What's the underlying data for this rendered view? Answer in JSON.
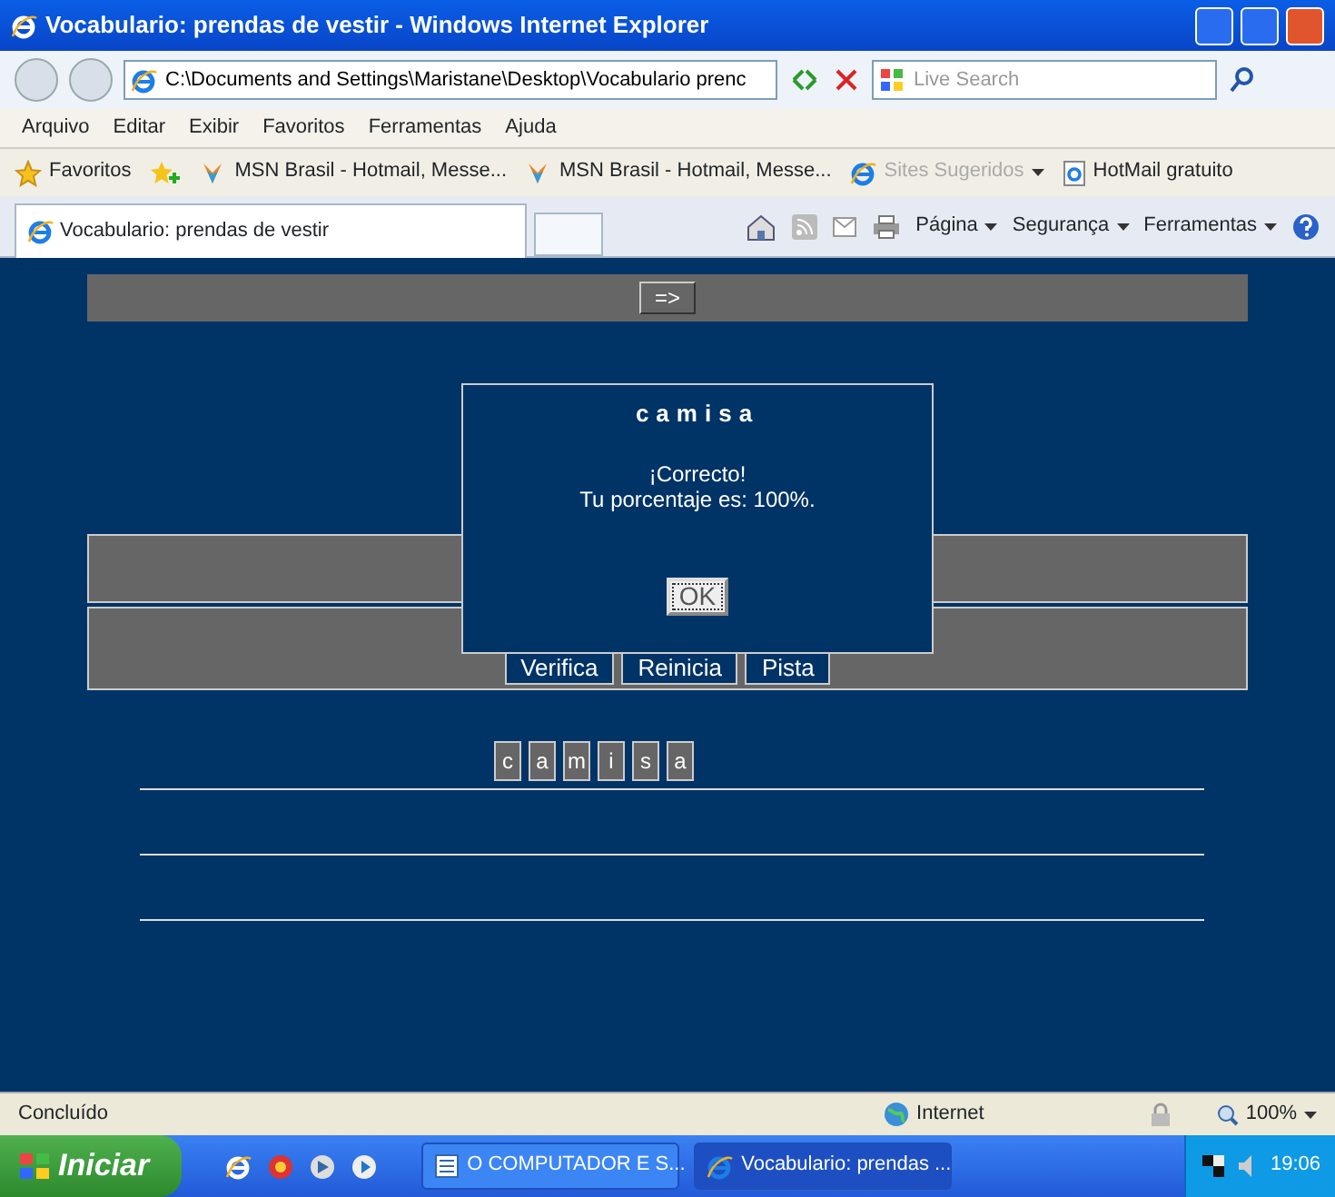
{
  "window": {
    "title": "Vocabulario: prendas de vestir - Windows Internet Explorer"
  },
  "address_bar": {
    "value": "C:\\Documents and Settings\\Maristane\\Desktop\\Vocabulario prenc"
  },
  "search": {
    "placeholder": "Live Search"
  },
  "menu": [
    "Arquivo",
    "Editar",
    "Exibir",
    "Favoritos",
    "Ferramentas",
    "Ajuda"
  ],
  "favorites_bar": {
    "label": "Favoritos",
    "links": [
      {
        "label": "MSN Brasil - Hotmail, Messe...",
        "kind": "msn",
        "disabled": false
      },
      {
        "label": "MSN Brasil - Hotmail, Messe...",
        "kind": "msn",
        "disabled": false
      },
      {
        "label": "Sites Sugeridos",
        "kind": "dropdown",
        "disabled": true
      },
      {
        "label": "HotMail gratuito",
        "kind": "page",
        "disabled": false
      }
    ]
  },
  "tabs": [
    {
      "label": "Vocabulario: prendas de vestir",
      "selected": true
    }
  ],
  "command_bar": [
    "Página",
    "Segurança",
    "Ferramentas"
  ],
  "page": {
    "next_button": "=>",
    "buttons": [
      "Verifica",
      "Reinicia",
      "Pista"
    ],
    "letters": [
      "c",
      "a",
      "m",
      "i",
      "s",
      "a"
    ]
  },
  "dialog": {
    "title": "camisa",
    "message": "¡Correcto!",
    "score": "Tu porcentaje es: 100%.",
    "button": "OK"
  },
  "status_bar": {
    "text": "Concluído",
    "zone": "Internet",
    "zoom": "100%"
  },
  "taskbar": {
    "start": "Iniciar",
    "windows": [
      {
        "label": "O COMPUTADOR E S...",
        "kind": "word",
        "selected": false
      },
      {
        "label": "Vocabulario: prendas ...",
        "kind": "ie",
        "selected": true
      }
    ],
    "clock": "19:06"
  }
}
